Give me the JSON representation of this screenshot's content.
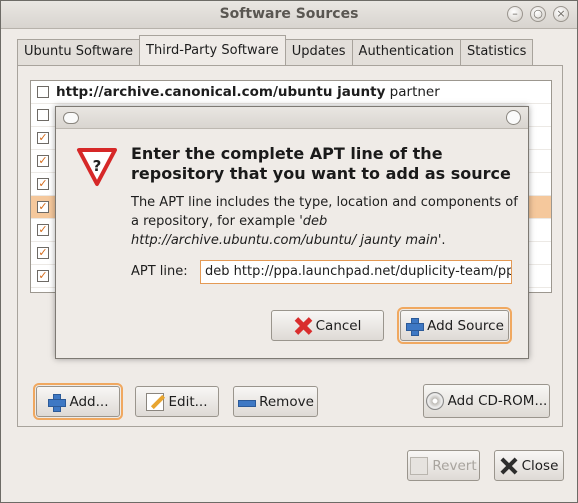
{
  "window": {
    "title": "Software Sources",
    "controls": {
      "minimize": "–",
      "maximize": "○",
      "close": "×"
    }
  },
  "tabs": [
    {
      "label": "Ubuntu Software",
      "active": false
    },
    {
      "label": "Third-Party Software",
      "active": true
    },
    {
      "label": "Updates",
      "active": false
    },
    {
      "label": "Authentication",
      "active": false
    },
    {
      "label": "Statistics",
      "active": false
    }
  ],
  "sources": [
    {
      "checked": false,
      "bold": "http://archive.canonical.com/ubuntu jaunty",
      "rest": " partner",
      "selected": false
    },
    {
      "checked": false,
      "bold": "",
      "rest": "",
      "selected": false
    },
    {
      "checked": true,
      "bold": "",
      "rest": "",
      "selected": false
    },
    {
      "checked": true,
      "bold": "",
      "rest": "",
      "selected": false
    },
    {
      "checked": true,
      "bold": "",
      "rest": "",
      "selected": false
    },
    {
      "checked": true,
      "bold": "",
      "rest": "",
      "selected": true
    },
    {
      "checked": true,
      "bold": "",
      "rest": "",
      "selected": false
    },
    {
      "checked": true,
      "bold": "",
      "rest": "",
      "selected": false
    },
    {
      "checked": true,
      "bold": "",
      "rest": "",
      "selected": false
    }
  ],
  "buttons": {
    "add": "Add...",
    "edit": "Edit...",
    "remove": "Remove",
    "add_cdrom": "Add CD-ROM...",
    "revert": "Revert",
    "close": "Close"
  },
  "dialog": {
    "heading": "Enter the complete APT line of the repository that you want to add as source",
    "body_1": "The APT line includes the type, location and components of a repository, for example ",
    "body_example": "'deb http://archive.ubuntu.com/ubuntu/ jaunty main'",
    "body_end": ".",
    "apt_label": "APT line:",
    "apt_value": "deb http://ppa.launchpad.net/duplicity-team/ppa/ubuntu jaunty main",
    "cancel": "Cancel",
    "add_source": "Add Source",
    "warn_glyph": "?"
  },
  "colors": {
    "selection": "#f5c89c",
    "focus": "#f0a860",
    "check": "#d46a1a"
  }
}
